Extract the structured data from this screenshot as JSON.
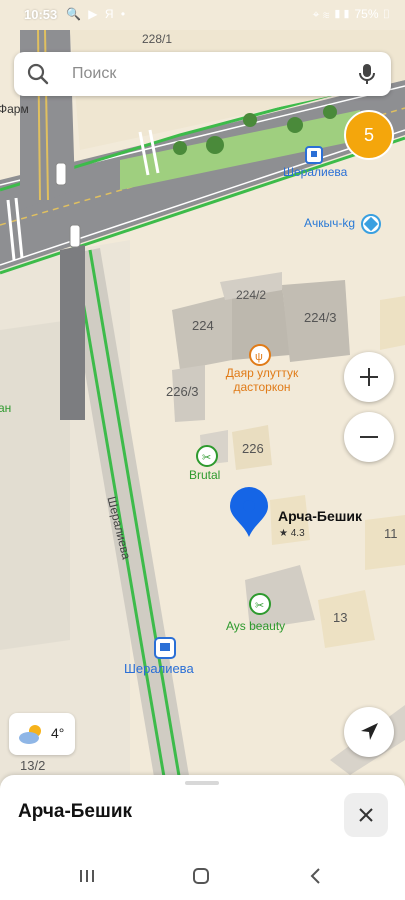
{
  "status_bar": {
    "time": "10:53",
    "left_icons": "🔍 ▶ Я •",
    "battery": "75%"
  },
  "search": {
    "placeholder": "Поиск"
  },
  "poi_count_badge": "5",
  "map_labels": {
    "building_228_1": "228/1",
    "pharmacy_partial": "Фарм",
    "stop_top": "Шералиева",
    "achkych": "Ачкыч-kg",
    "b224_2": "224/2",
    "b224": "224",
    "b224_3": "224/3",
    "b226_3": "226/3",
    "dayar_line1": "Даяр улуттук",
    "dayar_line2": "дасторкон",
    "b226": "226",
    "brutal": "Brutal",
    "street_vertical": "Шералиева",
    "selected_name": "Арча-Бешик",
    "selected_rating": "★ 4.3",
    "b11": "11",
    "b13": "13",
    "ays": "Ays beauty",
    "stop_bottom": "Шералиева",
    "b13_2": "13/2",
    "left_partial_an": "ан"
  },
  "weather": {
    "temp": "4°"
  },
  "sheet": {
    "title": "Арча-Бешик"
  },
  "colors": {
    "accent_blue": "#1565e6",
    "badge_orange": "#f4a60c",
    "poi_green": "#2e9a2e",
    "cafe_orange": "#e07b18",
    "route_green": "#3dbb4a"
  }
}
